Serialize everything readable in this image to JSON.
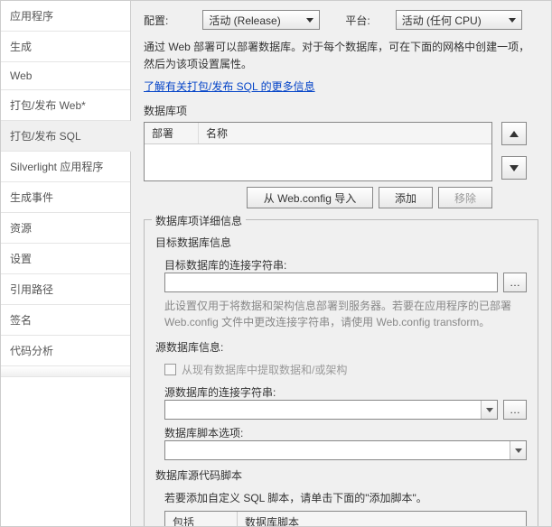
{
  "sidebar": {
    "items": [
      {
        "label": "应用程序"
      },
      {
        "label": "生成"
      },
      {
        "label": "Web"
      },
      {
        "label": "打包/发布 Web*"
      },
      {
        "label": "打包/发布 SQL"
      },
      {
        "label": "Silverlight 应用程序"
      },
      {
        "label": "生成事件"
      },
      {
        "label": "资源"
      },
      {
        "label": "设置"
      },
      {
        "label": "引用路径"
      },
      {
        "label": "签名"
      },
      {
        "label": "代码分析"
      }
    ],
    "selected_index": 4
  },
  "top": {
    "config_label": "配置:",
    "config_value": "活动 (Release)",
    "platform_label": "平台:",
    "platform_value": "活动 (任何 CPU)"
  },
  "intro": {
    "text": "通过 Web 部署可以部署数据库。对于每个数据库，可在下面的网格中创建一项，然后为该项设置属性。",
    "link": "了解有关打包/发布 SQL 的更多信息"
  },
  "db_items": {
    "title": "数据库项",
    "col_deploy": "部署",
    "col_name": "名称",
    "btn_import": "从 Web.config 导入",
    "btn_add": "添加",
    "btn_remove": "移除"
  },
  "details": {
    "legend": "数据库项详细信息",
    "target_title": "目标数据库信息",
    "target_conn_label": "目标数据库的连接字符串:",
    "target_note": "此设置仅用于将数据和架构信息部署到服务器。若要在应用程序的已部署 Web.config 文件中更改连接字符串，请使用 Web.config transform。",
    "source_title": "源数据库信息:",
    "source_checkbox": "从现有数据库中提取数据和/或架构",
    "source_conn_label": "源数据库的连接字符串:",
    "script_options_label": "数据库脚本选项:",
    "scripts_title": "数据库源代码脚本",
    "scripts_hint": "若要添加自定义 SQL 脚本，请单击下面的\"添加脚本\"。",
    "scripts_col_include": "包括",
    "scripts_col_name": "数据库脚本"
  }
}
